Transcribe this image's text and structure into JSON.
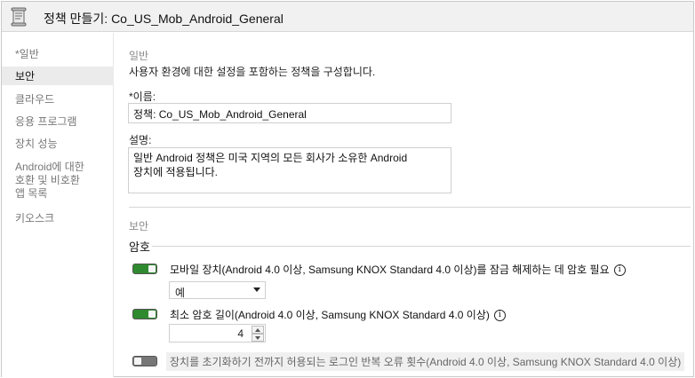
{
  "window": {
    "title": "정책 만들기: Co_US_Mob_Android_General",
    "icon": "document-scroll-icon"
  },
  "sidebar": {
    "items": [
      {
        "label": "*일반"
      },
      {
        "label": "보안"
      },
      {
        "label": "클라우드"
      },
      {
        "label": "응용 프로그램"
      },
      {
        "label": "장치 성능"
      },
      {
        "label": "Android에 대한 호환 및 비호환 앱 목록",
        "lines": [
          "Android에 대한",
          "호환 및 비호환",
          "앱 목록"
        ]
      },
      {
        "label": "키오스크"
      }
    ],
    "active_index": 1
  },
  "general": {
    "header": "일반",
    "description": "사용자 환경에 대한 설정을 포함하는 정책을 구성합니다.",
    "name_label": "*이름:",
    "name_value": "정책: Co_US_Mob_Android_General",
    "desc_label": "설명:",
    "desc_value_line1": "일반 Android 정책은 미국 지역의 모든 회사가 소유한 Android",
    "desc_value_line2": "장치에 적용됩니다."
  },
  "security": {
    "header": "보안",
    "group_title": "암호",
    "settings": [
      {
        "label": "모바일 장치(Android 4.0 이상, Samsung KNOX Standard 4.0 이상)를 잠금 해제하는 데 암호 필요",
        "enabled": true
      },
      {
        "label": "최소 암호 길이(Android 4.0 이상, Samsung KNOX Standard 4.0 이상)",
        "enabled": true
      },
      {
        "label": "장치를 초기화하기 전까지 허용되는 로그인 반복 오류 횟수(Android 4.0 이상, Samsung KNOX Standard 4.0 이상)",
        "enabled": false
      }
    ],
    "require_password_select": "예",
    "min_length_value": "4",
    "info_glyph": "i"
  },
  "colors": {
    "toggle_on": "#2f8a2f",
    "toggle_off": "#777777",
    "selected_nav_bg": "#ebebeb"
  }
}
